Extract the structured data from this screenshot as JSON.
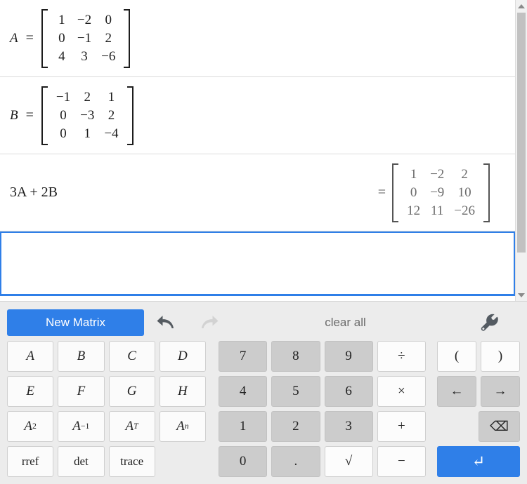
{
  "worksheet": {
    "definitions": [
      {
        "name": "matrix-a",
        "label": "A",
        "equals": "=",
        "rows": [
          [
            "1",
            "−2",
            "0"
          ],
          [
            "0",
            "−1",
            "2"
          ],
          [
            "4",
            "3",
            "−6"
          ]
        ]
      },
      {
        "name": "matrix-b",
        "label": "B",
        "equals": "=",
        "rows": [
          [
            "−1",
            "2",
            "1"
          ],
          [
            "0",
            "−3",
            "2"
          ],
          [
            "0",
            "1",
            "−4"
          ]
        ]
      }
    ],
    "expression": {
      "name": "expression-3a-2b",
      "text": "3A + 2B",
      "equals": "=",
      "result": [
        [
          "1",
          "−2",
          "2"
        ],
        [
          "0",
          "−9",
          "10"
        ],
        [
          "12",
          "11",
          "−26"
        ]
      ]
    },
    "input_row": {
      "value": "",
      "placeholder": ""
    }
  },
  "toolbar": {
    "new_matrix_label": "New Matrix",
    "undo_label": "undo",
    "redo_label": "redo",
    "clear_all_label": "clear all",
    "settings_label": "settings"
  },
  "keypad": {
    "matrix_keys": [
      {
        "label": "A",
        "style": "italic"
      },
      {
        "label": "B",
        "style": "italic"
      },
      {
        "label": "C",
        "style": "italic"
      },
      {
        "label": "D",
        "style": "italic"
      },
      {
        "label": "E",
        "style": "italic"
      },
      {
        "label": "F",
        "style": "italic"
      },
      {
        "label": "G",
        "style": "italic"
      },
      {
        "label": "H",
        "style": "italic"
      },
      {
        "label": "A2",
        "style": "sup",
        "base": "A",
        "exp": "2"
      },
      {
        "label": "A-1",
        "style": "sup",
        "base": "A",
        "exp": "−1"
      },
      {
        "label": "AT",
        "style": "sup",
        "base": "A",
        "exp": "T"
      },
      {
        "label": "An",
        "style": "sup",
        "base": "A",
        "exp": "n"
      },
      {
        "label": "rref",
        "style": "word"
      },
      {
        "label": "det",
        "style": "word"
      },
      {
        "label": "trace",
        "style": "word"
      },
      {
        "label": "",
        "style": "blank"
      }
    ],
    "number_keys": [
      {
        "label": "7",
        "tone": "grey"
      },
      {
        "label": "8",
        "tone": "grey"
      },
      {
        "label": "9",
        "tone": "grey"
      },
      {
        "label": "÷",
        "tone": "white"
      },
      {
        "label": "4",
        "tone": "grey"
      },
      {
        "label": "5",
        "tone": "grey"
      },
      {
        "label": "6",
        "tone": "grey"
      },
      {
        "label": "×",
        "tone": "white"
      },
      {
        "label": "1",
        "tone": "grey"
      },
      {
        "label": "2",
        "tone": "grey"
      },
      {
        "label": "3",
        "tone": "grey"
      },
      {
        "label": "+",
        "tone": "white"
      },
      {
        "label": "0",
        "tone": "grey"
      },
      {
        "label": ".",
        "tone": "grey"
      },
      {
        "label": "√",
        "tone": "white"
      },
      {
        "label": "−",
        "tone": "white"
      }
    ],
    "op_keys": [
      {
        "label": "(",
        "tone": "white",
        "name": "paren-open"
      },
      {
        "label": ")",
        "tone": "white",
        "name": "paren-close"
      },
      {
        "label": "←",
        "tone": "grey",
        "name": "arrow-left"
      },
      {
        "label": "→",
        "tone": "grey",
        "name": "arrow-right"
      },
      {
        "label": "⌫",
        "tone": "grey",
        "name": "backspace"
      },
      {
        "label": "↵",
        "tone": "blue",
        "name": "enter"
      }
    ]
  },
  "colors": {
    "accent_blue": "#2f7fe8",
    "key_grey": "#cccccc",
    "panel_grey": "#ececec",
    "scrollbar_thumb": "#c1c1c1"
  }
}
